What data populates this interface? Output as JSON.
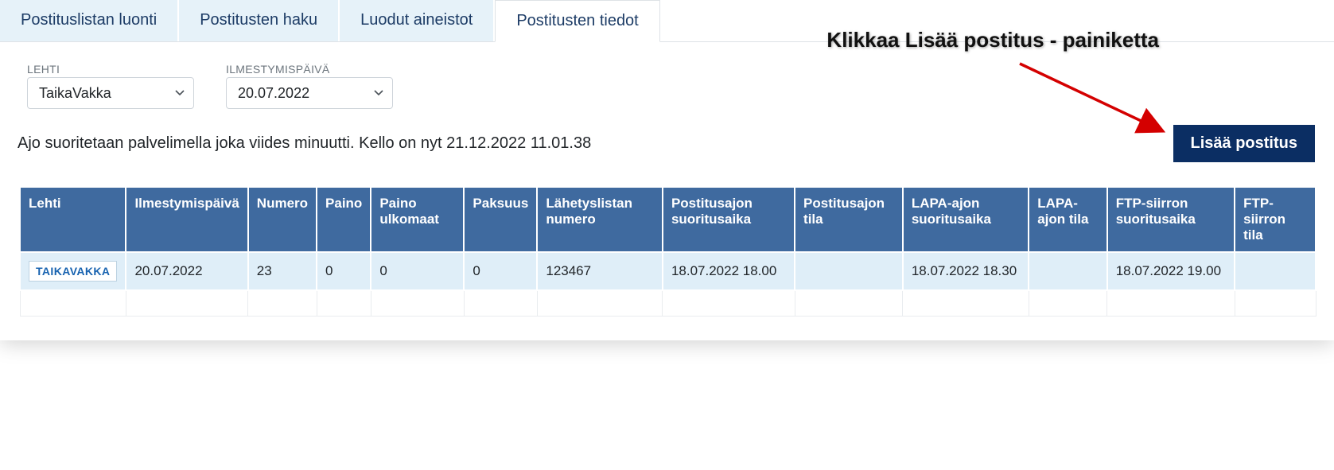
{
  "tabs": [
    {
      "label": "Postituslistan luonti",
      "active": false
    },
    {
      "label": "Postitusten haku",
      "active": false
    },
    {
      "label": "Luodut aineistot",
      "active": false
    },
    {
      "label": "Postitusten tiedot",
      "active": true
    }
  ],
  "filters": {
    "lehti": {
      "label": "LEHTI",
      "value": "TaikaVakka"
    },
    "ilmestymispaiva": {
      "label": "ILMESTYMISPÄIVÄ",
      "value": "20.07.2022"
    }
  },
  "status": {
    "text": "Ajo suoritetaan palvelimella joka viides minuutti. Kello on nyt 21.12.2022 11.01.38"
  },
  "callout": "Klikkaa Lisää postitus - painiketta",
  "add_button": "Lisää postitus",
  "table": {
    "headers": [
      "Lehti",
      "Ilmestymispäivä",
      "Numero",
      "Paino",
      "Paino ulkomaat",
      "Paksuus",
      "Lähetyslistan numero",
      "Postitusajon suoritusaika",
      "Postitusajon tila",
      "LAPA-ajon suoritusaika",
      "LAPA-ajon tila",
      "FTP-siirron suoritusaika",
      "FTP-siirron tila"
    ],
    "rows": [
      {
        "lehti_badge": "TAIKAVAKKA",
        "ilmestymispaiva": "20.07.2022",
        "numero": "23",
        "paino": "0",
        "paino_ulkomaat": "0",
        "paksuus": "0",
        "lahetyslistan_numero": "123467",
        "postitusajon_suoritusaika": "18.07.2022 18.00",
        "postitusajon_tila": "",
        "lapa_ajon_suoritusaika": "18.07.2022 18.30",
        "lapa_ajon_tila": "",
        "ftp_siirron_suoritusaika": "18.07.2022 19.00",
        "ftp_siirron_tila": ""
      }
    ]
  }
}
